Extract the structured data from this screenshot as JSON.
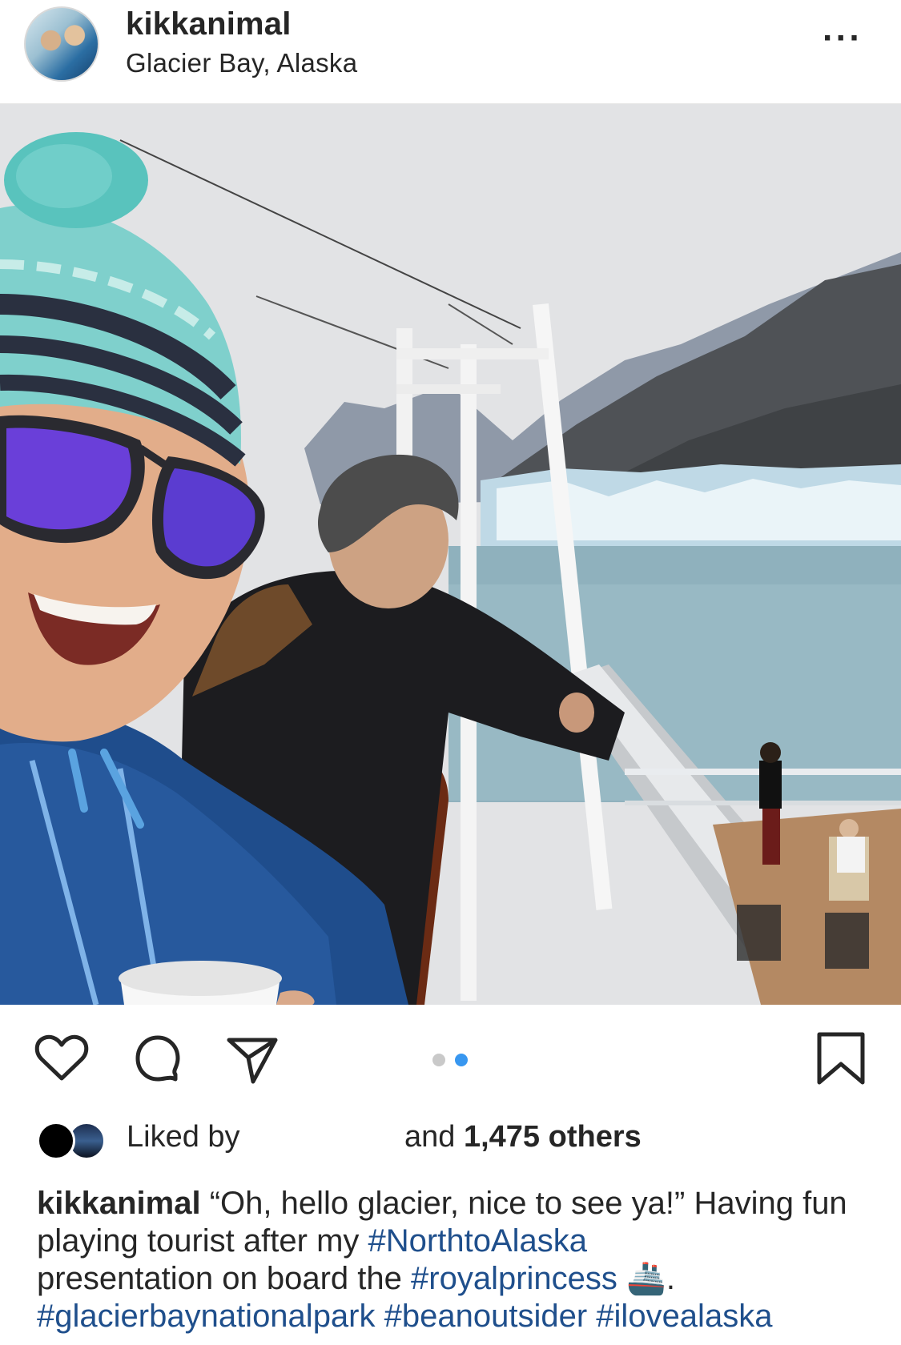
{
  "post": {
    "username": "kikkanimal",
    "location": "Glacier Bay, Alaska"
  },
  "icons": {
    "more": "more-horizontal-icon",
    "like": "heart-outline-icon",
    "comment": "comment-bubble-icon",
    "share": "paper-plane-icon",
    "save": "bookmark-icon"
  },
  "carousel": {
    "total": 2,
    "current": 2
  },
  "likes": {
    "liked_by_label": "Liked by",
    "and_label": "and",
    "count_label": "1,475 others"
  },
  "caption": {
    "username": "kikkanimal",
    "text_1": "“Oh, hello glacier, nice to see ya!” Having fun playing tourist after my",
    "tag_1": "#NorthtoAlaska",
    "text_2": "presentation on board the",
    "tag_2": "#royalprincess",
    "emoji": "🚢",
    "text_3": ".",
    "tag_3": "#glacierbaynationalpark",
    "tag_4": "#beanoutsider",
    "tag_5": "#ilovealaska"
  },
  "colors": {
    "link": "#1f4f8c",
    "carousel_active": "#3897f0",
    "carousel_inactive": "#c9c9c9"
  }
}
